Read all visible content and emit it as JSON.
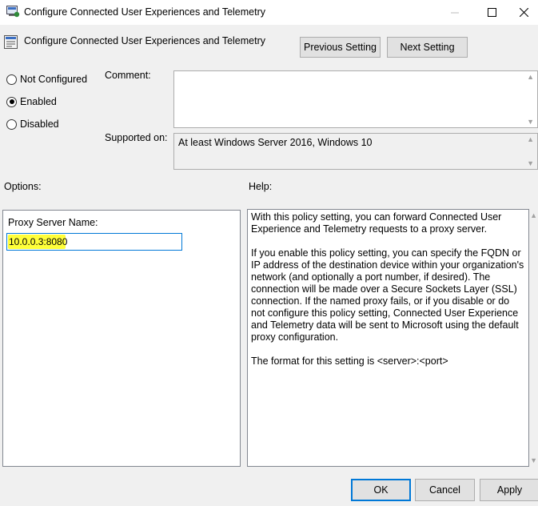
{
  "window": {
    "title": "Configure Connected User Experiences and Telemetry"
  },
  "header": {
    "title": "Configure Connected User Experiences and Telemetry",
    "previous_label": "Previous Setting",
    "next_label": "Next Setting"
  },
  "state": {
    "options": [
      {
        "label": "Not Configured",
        "checked": false
      },
      {
        "label": "Enabled",
        "checked": true
      },
      {
        "label": "Disabled",
        "checked": false
      }
    ]
  },
  "comment": {
    "label": "Comment:",
    "value": ""
  },
  "supported": {
    "label": "Supported on:",
    "value": "At least Windows Server 2016, Windows 10"
  },
  "options_section": {
    "heading": "Options:",
    "proxy_label": "Proxy Server Name:",
    "proxy_value": "10.0.0.3:8080"
  },
  "help_section": {
    "heading": "Help:",
    "paragraphs": [
      "With this policy setting, you can forward Connected User Experience and Telemetry requests to a proxy server.",
      "If you enable this policy setting, you can specify the FQDN or IP address of the destination device within your organization's network (and optionally a port number, if desired). The connection will be made over a Secure Sockets Layer (SSL) connection.  If the named proxy fails, or if you disable or do not configure this policy setting, Connected User Experience and Telemetry data will be sent to Microsoft using the default proxy configuration.",
      "The format for this setting is <server>:<port>"
    ]
  },
  "footer": {
    "ok_label": "OK",
    "cancel_label": "Cancel",
    "apply_label": "Apply"
  },
  "icons": {
    "app": "group-policy-icon",
    "setting": "policy-setting-icon"
  },
  "colors": {
    "accent": "#0078d7",
    "highlight": "#ffff3a"
  }
}
